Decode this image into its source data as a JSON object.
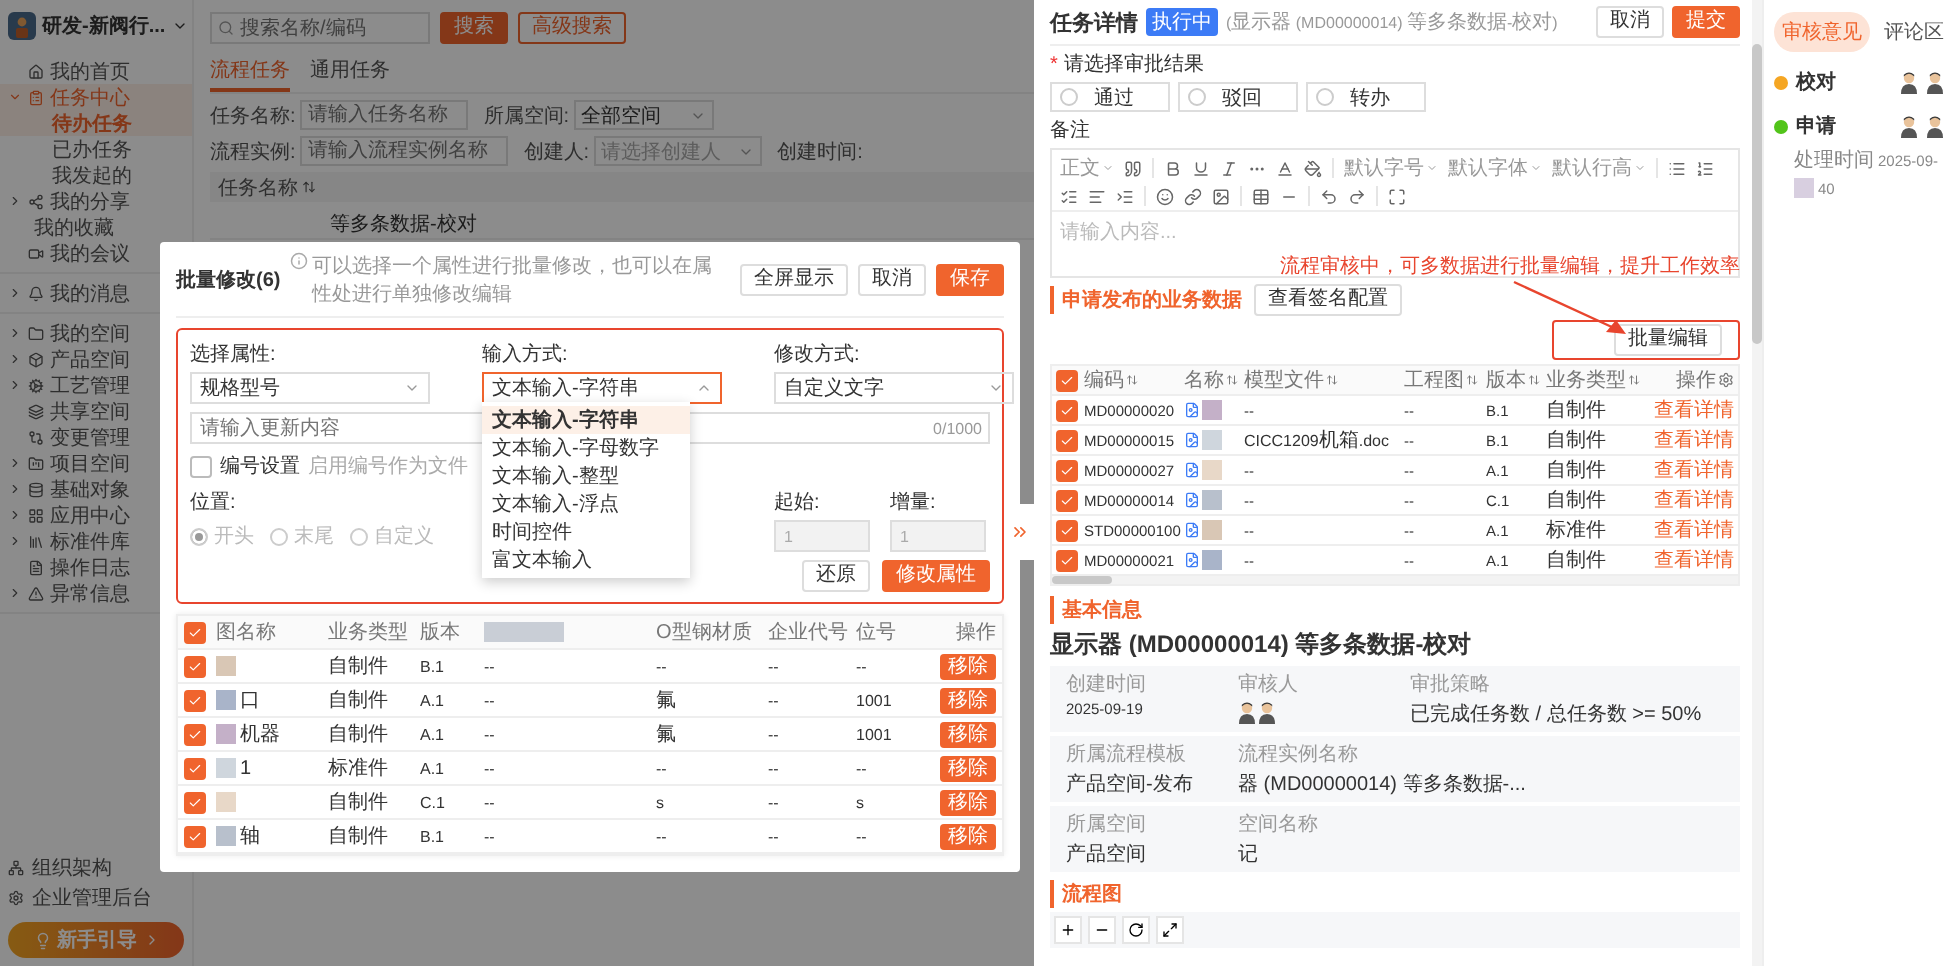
{
  "app": {
    "org": {
      "name": "研发-新阀行..."
    },
    "sidebar": {
      "groups": [
        {
          "items": [
            {
              "label": "我的首页",
              "kind": "link",
              "selected": false
            },
            {
              "label": "任务中心",
              "kind": "group",
              "expanded": true,
              "selected": true,
              "children": [
                {
                  "label": "待办任务",
                  "selected": true
                },
                {
                  "label": "已办任务",
                  "selected": false
                },
                {
                  "label": "我发起的",
                  "selected": false
                }
              ]
            },
            {
              "label": "我的分享",
              "kind": "group",
              "expanded": false,
              "selected": false
            },
            {
              "label": "我的收藏",
              "kind": "link",
              "selected": false
            },
            {
              "label": "我的会议",
              "kind": "link",
              "selected": false
            }
          ]
        },
        {
          "items": [
            {
              "label": "我的消息",
              "kind": "group",
              "expanded": false,
              "selected": false
            }
          ]
        },
        {
          "items": [
            {
              "label": "我的空间",
              "kind": "group",
              "expanded": false,
              "selected": false
            },
            {
              "label": "产品空间",
              "kind": "group",
              "expanded": false,
              "selected": false
            },
            {
              "label": "工艺管理",
              "kind": "group",
              "expanded": false,
              "selected": false
            },
            {
              "label": "共享空间",
              "kind": "link",
              "selected": false
            },
            {
              "label": "变更管理",
              "kind": "link",
              "selected": false
            },
            {
              "label": "项目空间",
              "kind": "group",
              "expanded": false,
              "selected": false
            },
            {
              "label": "基础对象",
              "kind": "group",
              "expanded": false,
              "selected": false
            },
            {
              "label": "应用中心",
              "kind": "group",
              "expanded": false,
              "selected": false
            },
            {
              "label": "标准件库",
              "kind": "group",
              "expanded": false,
              "selected": false
            },
            {
              "label": "操作日志",
              "kind": "link",
              "selected": false
            },
            {
              "label": "异常信息",
              "kind": "group",
              "expanded": false,
              "selected": false
            }
          ]
        }
      ],
      "footer_links": [
        "组织架构",
        "企业管理后台"
      ],
      "guide_button": "新手引导"
    },
    "search": {
      "placeholder": "搜索名称/编码",
      "buttons": [
        {
          "label": "搜索",
          "kind": "primary"
        },
        {
          "label": "高级搜索",
          "kind": "outline"
        }
      ]
    },
    "tabs": [
      {
        "label": "流程任务",
        "selected": true
      },
      {
        "label": "通用任务",
        "selected": false
      }
    ],
    "filters": [
      {
        "label": "任务名称:",
        "kind": "input",
        "placeholder": "请输入任务名称"
      },
      {
        "label": "所属空间:",
        "kind": "select",
        "value": "全部空间"
      },
      {
        "label": "流程实例:",
        "kind": "input",
        "placeholder": "请输入流程实例名称"
      },
      {
        "label": "创建人:",
        "kind": "select",
        "placeholder": "请选择创建人"
      },
      {
        "label": "创建时间:",
        "kind": "label"
      }
    ],
    "table": {
      "columns": [
        "任务名称"
      ],
      "rows": [
        [
          "等多条数据-校对"
        ]
      ]
    }
  },
  "modal": {
    "title": "批量修改(6)",
    "hint": "可以选择一个属性进行批量修改，也可以在属性处进行单独修改编辑",
    "buttons": [
      {
        "label": "全屏显示",
        "kind": "default"
      },
      {
        "label": "取消",
        "kind": "default"
      },
      {
        "label": "保存",
        "kind": "primary"
      }
    ],
    "fields": [
      {
        "label": "选择属性:",
        "value": "规格型号",
        "open": false
      },
      {
        "label": "输入方式:",
        "value": "文本输入-字符串",
        "open": true,
        "options": [
          {
            "label": "文本输入-字符串",
            "selected": true
          },
          {
            "label": "文本输入-字母数字",
            "selected": false
          },
          {
            "label": "文本输入-整型",
            "selected": false
          },
          {
            "label": "文本输入-浮点",
            "selected": false
          },
          {
            "label": "时间控件",
            "selected": false
          },
          {
            "label": "富文本输入",
            "selected": false
          }
        ]
      },
      {
        "label": "修改方式:",
        "value": "自定义文字",
        "open": false
      }
    ],
    "content": {
      "placeholder": "请输入更新内容",
      "counter": "0/1000"
    },
    "numbering": {
      "label": "编号设置",
      "checked": false,
      "hint": "启用编号作为文件"
    },
    "position": {
      "label": "位置:",
      "disabled": true,
      "options": [
        {
          "label": "开头",
          "selected": true
        },
        {
          "label": "末尾",
          "selected": false
        },
        {
          "label": "自定义",
          "selected": false
        }
      ]
    },
    "start": {
      "label": "起始:",
      "value": "1",
      "disabled": true
    },
    "step": {
      "label": "增量:",
      "value": "1",
      "disabled": true
    },
    "actions": [
      {
        "label": "还原",
        "kind": "default"
      },
      {
        "label": "修改属性",
        "kind": "primary"
      }
    ],
    "table": {
      "header_checked": true,
      "columns": [
        {
          "label": "图名称"
        },
        {
          "label": "业务类型"
        },
        {
          "label": "版本"
        },
        {
          "redacted": true
        },
        {
          "label": "O型钢材质"
        },
        {
          "label": "企业代号"
        },
        {
          "label": "位号"
        },
        {
          "label": "操作"
        }
      ],
      "rows": [
        {
          "checked": true,
          "cells": [
            "",
            "自制件",
            "B.1",
            "--",
            "--",
            "--",
            "--"
          ],
          "action": "移除"
        },
        {
          "checked": true,
          "cells": [
            "口",
            "自制件",
            "A.1",
            "--",
            "氟",
            "--",
            "1001"
          ],
          "action": "移除"
        },
        {
          "checked": true,
          "cells": [
            "机器",
            "自制件",
            "A.1",
            "--",
            "氟",
            "--",
            "1001"
          ],
          "action": "移除"
        },
        {
          "checked": true,
          "cells": [
            "1",
            "标准件",
            "A.1",
            "--",
            "--",
            "--",
            "--"
          ],
          "action": "移除"
        },
        {
          "checked": true,
          "cells": [
            "",
            "自制件",
            "C.1",
            "--",
            "s",
            "--",
            "s"
          ],
          "action": "移除"
        },
        {
          "checked": true,
          "cells": [
            "轴",
            "自制件",
            "B.1",
            "--",
            "--",
            "--",
            "--"
          ],
          "action": "移除"
        }
      ]
    }
  },
  "drawer": {
    "title": "任务详情",
    "status": "执行中",
    "subtitle": "(显示器 (MD00000014) 等多条数据-校对)",
    "buttons": [
      {
        "label": "取消",
        "kind": "default"
      },
      {
        "label": "提交",
        "kind": "primary"
      }
    ],
    "result": {
      "label": "请选择审批结果",
      "required_mark": "*",
      "options": [
        {
          "label": "通过",
          "selected": false
        },
        {
          "label": "驳回",
          "selected": false
        },
        {
          "label": "转办",
          "selected": false
        }
      ]
    },
    "remark_label": "备注",
    "editor": {
      "selects": [
        "正文",
        "默认字号",
        "默认字体",
        "默认行高"
      ],
      "placeholder": "请输入内容..."
    },
    "annotation": "流程审核中，可多数据进行批量编辑，提升工作效率",
    "business": {
      "title": "申请发布的业务数据",
      "config_button": "查看签名配置",
      "batch_button": "批量编辑",
      "header_checked": true,
      "columns": [
        "编码",
        "名称",
        "模型文件",
        "工程图",
        "版本",
        "业务类型",
        "操作"
      ],
      "rows": [
        {
          "checked": true,
          "code": "MD00000020",
          "model": "--",
          "drawing": "--",
          "version": "B.1",
          "type": "自制件",
          "action": "查看详情"
        },
        {
          "checked": true,
          "code": "MD00000015",
          "model": "CICC1209机箱.doc",
          "drawing": "--",
          "version": "B.1",
          "type": "自制件",
          "action": "查看详情"
        },
        {
          "checked": true,
          "code": "MD00000027",
          "model": "--",
          "drawing": "--",
          "version": "A.1",
          "type": "自制件",
          "action": "查看详情"
        },
        {
          "checked": true,
          "code": "MD00000014",
          "model": "--",
          "drawing": "--",
          "version": "C.1",
          "type": "自制件",
          "action": "查看详情"
        },
        {
          "checked": true,
          "code": "STD00000100",
          "model": "--",
          "drawing": "--",
          "version": "A.1",
          "type": "标准件",
          "action": "查看详情"
        },
        {
          "checked": true,
          "code": "MD00000021",
          "model": "--",
          "drawing": "--",
          "version": "A.1",
          "type": "自制件",
          "action": "查看详情"
        }
      ]
    },
    "basic": {
      "section": "基本信息",
      "title": "显示器 (MD00000014) 等多条数据-校对",
      "cards": [
        [
          {
            "label": "创建时间",
            "kind": "text",
            "value": "2025-09-19"
          },
          {
            "label": "审核人",
            "kind": "avatars"
          },
          {
            "label": "审批策略",
            "kind": "text",
            "value": "已完成任务数 / 总任务数 >= 50%"
          }
        ],
        [
          {
            "label": "所属流程模板",
            "kind": "text",
            "value": "产品空间-发布"
          },
          {
            "label": "流程实例名称",
            "kind": "text",
            "value": "器 (MD00000014) 等多条数据-..."
          }
        ],
        [
          {
            "label": "所属空间",
            "kind": "text",
            "value": "产品空间"
          },
          {
            "label": "空间名称",
            "kind": "text",
            "value": "记"
          }
        ]
      ]
    },
    "flow_section": "流程图"
  },
  "audit": {
    "tabs": [
      {
        "label": "审核意见",
        "selected": true
      },
      {
        "label": "评论区",
        "selected": false
      }
    ],
    "timeline": [
      {
        "label": "校对",
        "color": "#f5a623"
      },
      {
        "label": "申请",
        "color": "#52c41a",
        "time_label": "处理时间",
        "time": "2025-09-",
        "time_suffix": "40"
      }
    ]
  }
}
